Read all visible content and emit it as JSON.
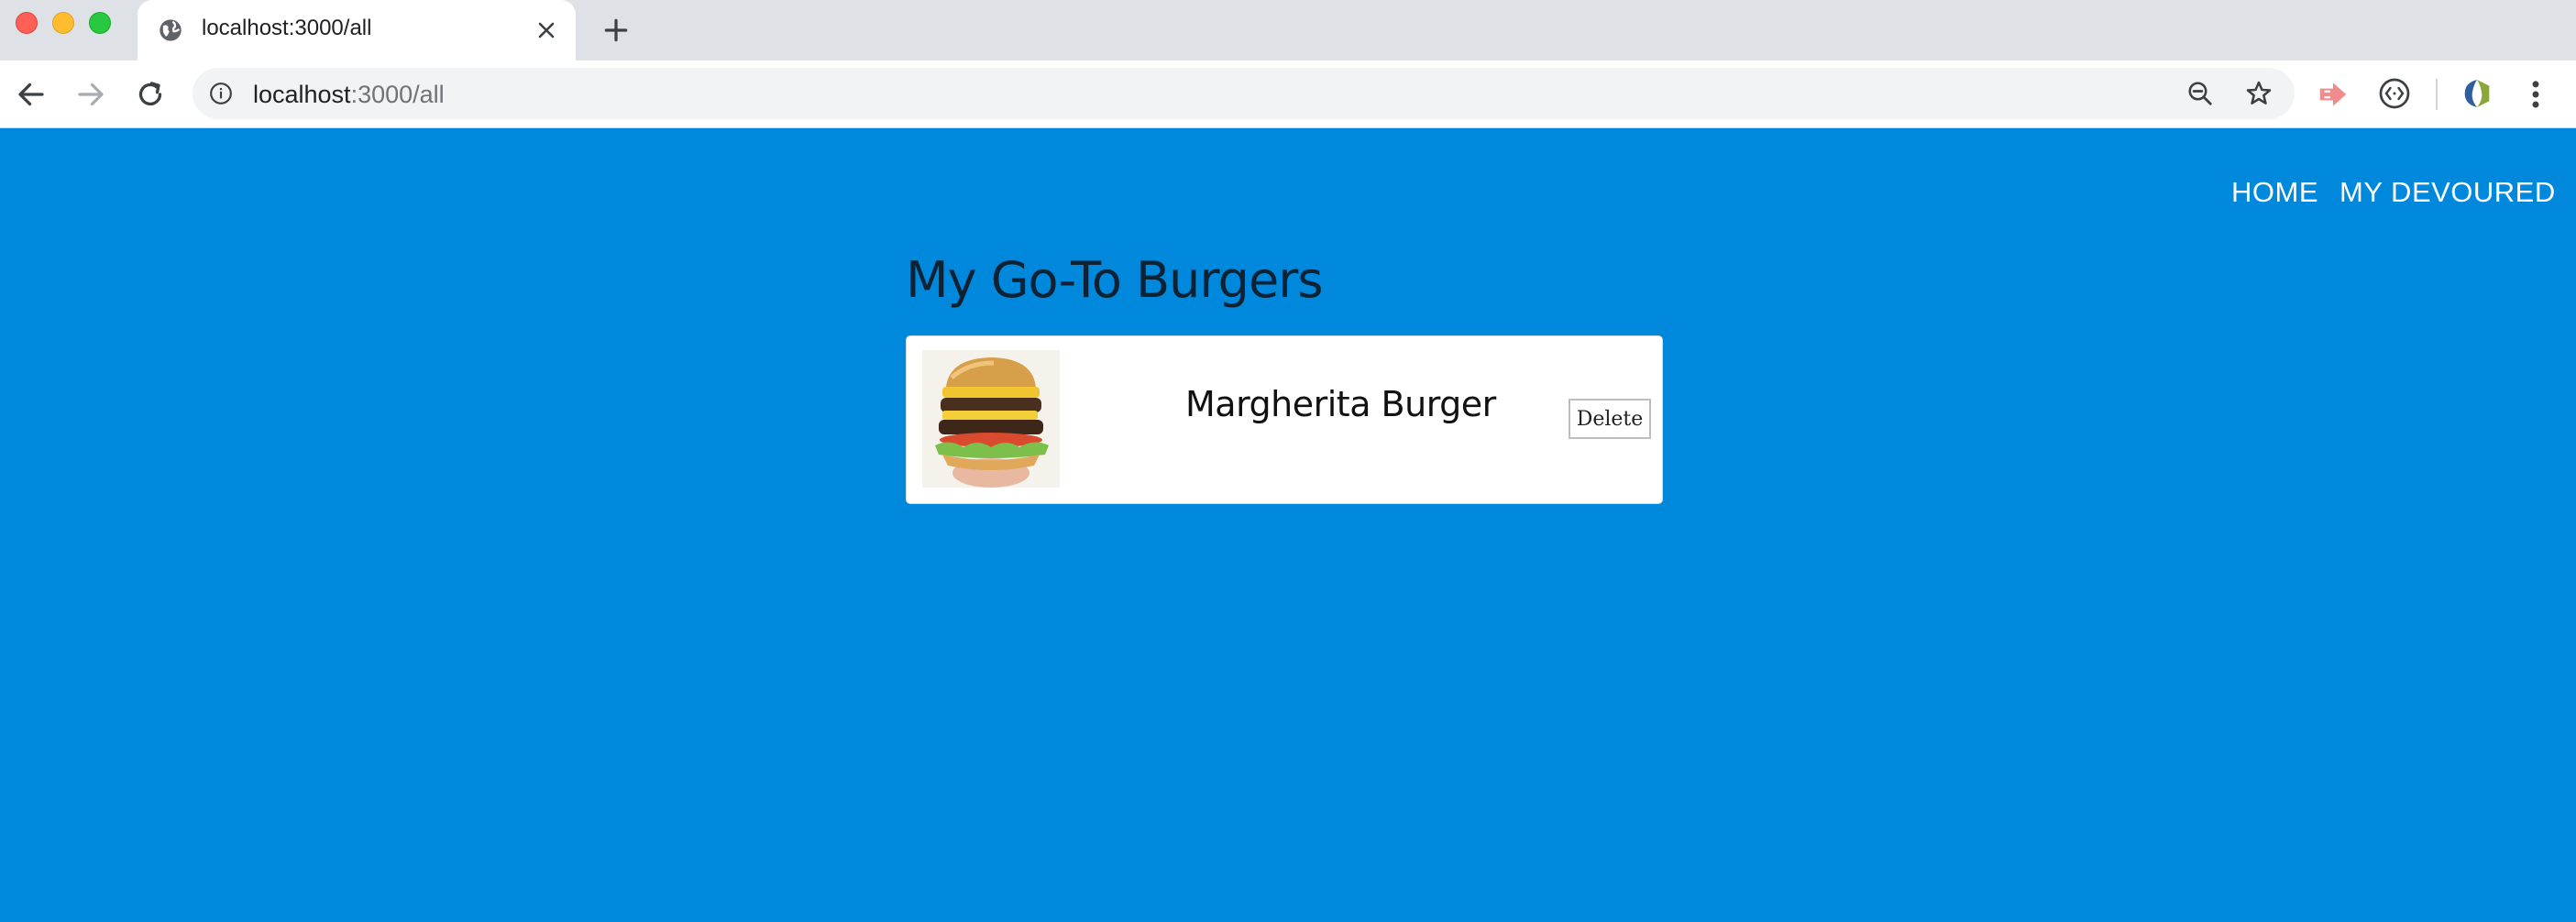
{
  "browser": {
    "tab": {
      "title": "localhost:3000/all"
    },
    "address": {
      "host": "localhost",
      "path": ":3000/all"
    }
  },
  "nav": {
    "home": "HOME",
    "devoured": "MY DEVOURED"
  },
  "main": {
    "title": "My Go-To Burgers",
    "burgers": [
      {
        "name": "Margherita Burger",
        "delete_label": "Delete"
      }
    ]
  },
  "colors": {
    "page_background": "#0088dd",
    "card_background": "#ffffff"
  }
}
